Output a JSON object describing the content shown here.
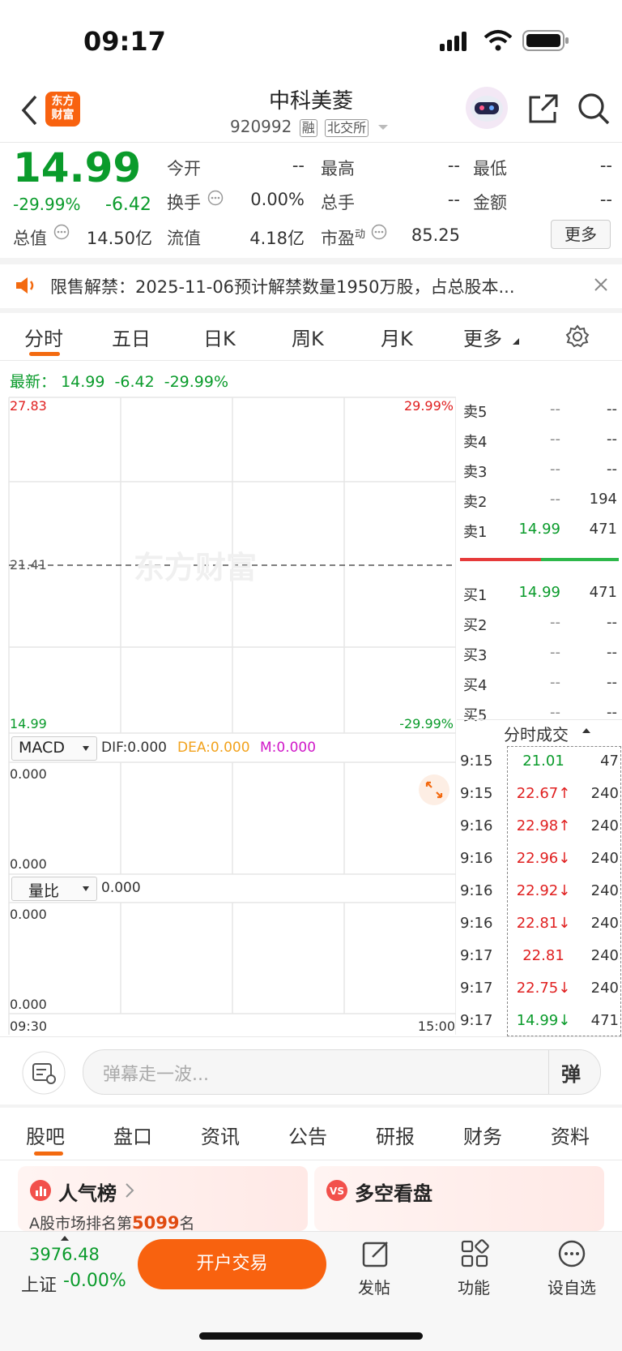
{
  "status": {
    "time": "09:17"
  },
  "header": {
    "logo_text": "东方\n财富",
    "stock_name": "中科美菱",
    "stock_code": "920992",
    "tag_margin": "融",
    "tag_exchange": "北交所"
  },
  "quote": {
    "price": "14.99",
    "change_pct": "-29.99%",
    "change": "-6.42",
    "open_label": "今开",
    "open_value": "--",
    "high_label": "最高",
    "high_value": "--",
    "low_label": "最低",
    "low_value": "--",
    "turnover_label": "换手",
    "turnover_value": "0.00%",
    "volume_label": "总手",
    "volume_value": "--",
    "amount_label": "金额",
    "amount_value": "--",
    "mktcap_label": "总值",
    "mktcap_value": "14.50亿",
    "float_label": "流值",
    "float_value": "4.18亿",
    "pe_label": "市盈",
    "pe_sup": "动",
    "pe_value": "85.25",
    "more_button": "更多"
  },
  "notice": {
    "text": "限售解禁：2025-11-06预计解禁数量1950万股，占总股本..."
  },
  "chart_tabs": [
    "分时",
    "五日",
    "日K",
    "周K",
    "月K",
    "更多"
  ],
  "latest": {
    "label": "最新：",
    "price": "14.99",
    "change": "-6.42",
    "pct": "-29.99%"
  },
  "chart_data": {
    "type": "line",
    "title": "",
    "y_left_top": "27.83",
    "y_left_mid": "21.41",
    "y_left_bottom": "14.99",
    "y_right_top": "29.99%",
    "y_right_bottom": "-29.99%",
    "x_start": "09:30",
    "x_end": "15:00",
    "ylim": [
      14.99,
      27.83
    ],
    "prev_close": 21.41,
    "watermark": "东方财富",
    "series": []
  },
  "macd": {
    "selector": "MACD",
    "dif": "DIF:0.000",
    "dea": "DEA:0.000",
    "m": "M:0.000",
    "top": "0.000",
    "bottom": "0.000"
  },
  "volratio": {
    "selector": "量比",
    "value": "0.000",
    "top": "0.000",
    "bottom": "0.000"
  },
  "orderbook": {
    "sells": [
      {
        "label": "卖5",
        "price": "--",
        "vol": "--"
      },
      {
        "label": "卖4",
        "price": "--",
        "vol": "--"
      },
      {
        "label": "卖3",
        "price": "--",
        "vol": "--"
      },
      {
        "label": "卖2",
        "price": "--",
        "vol": "194"
      },
      {
        "label": "卖1",
        "price": "14.99",
        "vol": "471"
      }
    ],
    "buys": [
      {
        "label": "买1",
        "price": "14.99",
        "vol": "471"
      },
      {
        "label": "买2",
        "price": "--",
        "vol": "--"
      },
      {
        "label": "买3",
        "price": "--",
        "vol": "--"
      },
      {
        "label": "买4",
        "price": "--",
        "vol": "--"
      },
      {
        "label": "买5",
        "price": "--",
        "vol": "--"
      }
    ]
  },
  "trades": {
    "title": "分时成交",
    "rows": [
      {
        "time": "9:15",
        "price": "21.01",
        "arrow": "",
        "vol": "47",
        "color": "#0a9b2b"
      },
      {
        "time": "9:15",
        "price": "22.67",
        "arrow": "↑",
        "vol": "240",
        "color": "#e02020"
      },
      {
        "time": "9:16",
        "price": "22.98",
        "arrow": "↑",
        "vol": "240",
        "color": "#e02020"
      },
      {
        "time": "9:16",
        "price": "22.96",
        "arrow": "↓",
        "vol": "240",
        "color": "#e02020"
      },
      {
        "time": "9:16",
        "price": "22.92",
        "arrow": "↓",
        "vol": "240",
        "color": "#e02020"
      },
      {
        "time": "9:16",
        "price": "22.81",
        "arrow": "↓",
        "vol": "240",
        "color": "#e02020"
      },
      {
        "time": "9:17",
        "price": "22.81",
        "arrow": "",
        "vol": "240",
        "color": "#e02020"
      },
      {
        "time": "9:17",
        "price": "22.75",
        "arrow": "↓",
        "vol": "240",
        "color": "#e02020"
      },
      {
        "time": "9:17",
        "price": "14.99",
        "arrow": "↓",
        "vol": "471",
        "color": "#0a9b2b"
      }
    ]
  },
  "danmu": {
    "placeholder": "弹幕走一波...",
    "button": "弹"
  },
  "bottom_tabs": [
    "股吧",
    "盘口",
    "资讯",
    "公告",
    "研报",
    "财务",
    "资料"
  ],
  "cards": {
    "popularity_title": "人气榜",
    "popularity_text_prefix": "A股市场排名第",
    "popularity_rank": "5099",
    "popularity_text_suffix": "名",
    "longshort_title": "多空看盘"
  },
  "footer": {
    "index_value": "3976.48",
    "index_name": "上证",
    "index_change": "-0.00%",
    "trade_button": "开户交易",
    "post_label": "发帖",
    "func_label": "功能",
    "watch_label": "设自选"
  }
}
